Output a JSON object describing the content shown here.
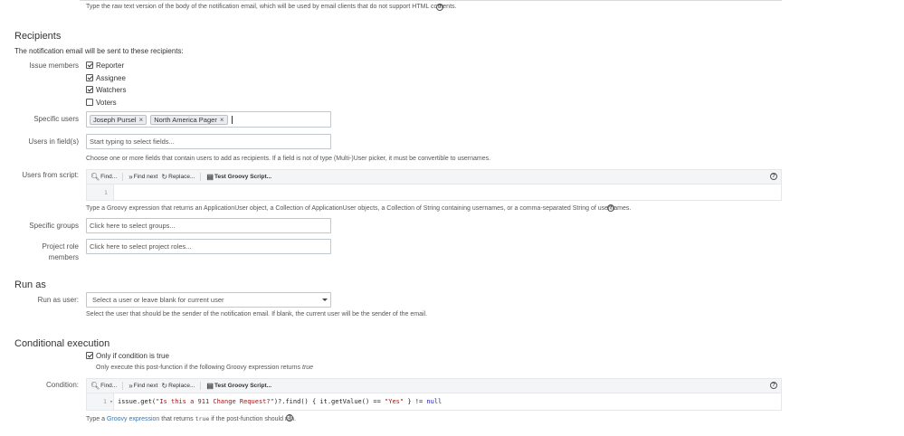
{
  "top_desc": {
    "text": "Type the raw text version of the body of the notification email, which will be used by email clients that do not support HTML contents.",
    "help_icon": "question-circle-icon"
  },
  "recipients": {
    "heading": "Recipients",
    "intro": "The notification email will be sent to these recipients:",
    "issue_members_label": "Issue members",
    "checkboxes": [
      {
        "label": "Reporter",
        "checked": true
      },
      {
        "label": "Assignee",
        "checked": true
      },
      {
        "label": "Watchers",
        "checked": true
      },
      {
        "label": "Voters",
        "checked": false
      }
    ],
    "specific_users_label": "Specific users",
    "specific_users_chips": [
      "Joseph Pursel",
      "North America Pager"
    ],
    "users_in_fields_label": "Users in field(s)",
    "users_in_fields_placeholder": "Start typing to select fields...",
    "users_in_fields_desc": "Choose one or more fields that contain users to add as recipients. If a field is not of type (Multi-)User picker, it must be convertible to usernames.",
    "users_from_script_label": "Users from script:",
    "toolbar": {
      "find": "Find...",
      "find_next": "Find next",
      "replace": "Replace...",
      "test": "Test Groovy Script..."
    },
    "script_line_number": "1",
    "script_desc": "Type a Groovy expression that returns an ApplicationUser object, a Collection of ApplicationUser objects, a Collection of String containing usernames, or a comma-separated String of usernames.",
    "specific_groups_label": "Specific groups",
    "specific_groups_placeholder": "Click here to select groups...",
    "project_role_label_1": "Project role",
    "project_role_label_2": "members",
    "project_role_placeholder": "Click here to select project roles..."
  },
  "run_as": {
    "heading": "Run as",
    "label": "Run as user:",
    "select_value": "Select a user or leave blank for current user",
    "desc": "Select the user that should be the sender of the notification email. If blank, the current user will be the sender of the email."
  },
  "conditional": {
    "heading": "Conditional execution",
    "checkbox_label": "Only if condition is true",
    "checkbox_checked": true,
    "sub_desc_prefix": "Only execute this post-function if the following Groovy expression returns ",
    "sub_desc_italic": "true",
    "condition_label": "Condition:",
    "toolbar": {
      "find": "Find...",
      "find_next": "Find next",
      "replace": "Replace...",
      "test": "Test Groovy Script..."
    },
    "line_number": "1",
    "fold_marker": "▾",
    "code": {
      "p1": "issue.get(",
      "s1": "\"Is this a 911 Change Request?\"",
      "p2": ")?.find() { it.getValue() == ",
      "s2": "\"Yes\"",
      "p3": " } != ",
      "kw": "null"
    },
    "desc_prefix": "Type a ",
    "desc_link": "Groovy expression",
    "desc_mid": " that returns ",
    "desc_code": "true",
    "desc_suffix": " if the post-function should run."
  }
}
